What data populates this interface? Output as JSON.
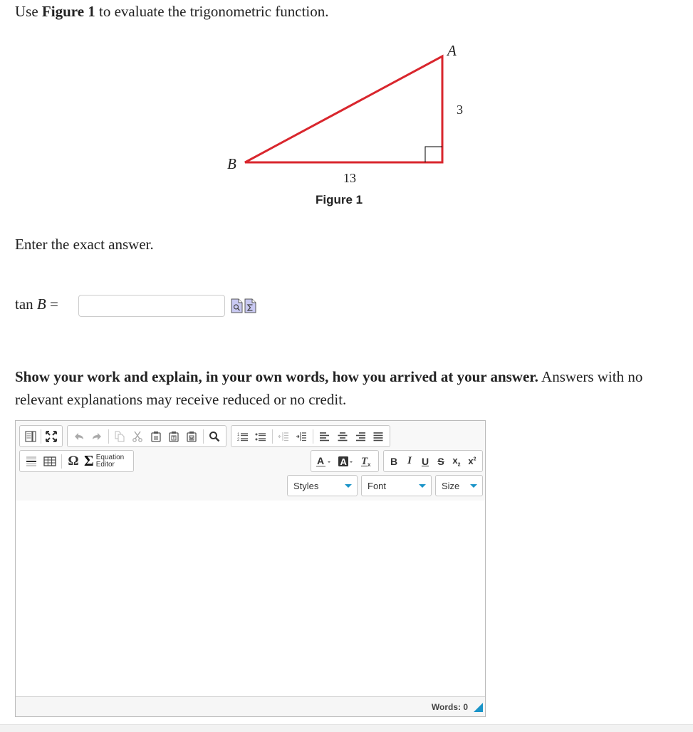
{
  "question": {
    "intro_prefix": "Use ",
    "intro_bold": "Figure 1",
    "intro_suffix": " to evaluate the trigonometric function.",
    "enter_exact": "Enter the exact answer.",
    "answer_label_fn": "tan",
    "answer_label_var": "B",
    "answer_label_eq": "=",
    "answer_value": "",
    "answer_placeholder": ""
  },
  "figure": {
    "caption": "Figure 1",
    "vertex_a": "A",
    "vertex_b": "B",
    "side_vertical": "3",
    "side_horizontal": "13",
    "line_color": "#d9262d",
    "right_angle_marker": true
  },
  "tool_icons": {
    "preview": "preview-icon",
    "equation": "equation-icon"
  },
  "show_work": {
    "bold": "Show your work and explain, in your own words, how you arrived at your answer.",
    "normal": " Answers with no relevant explanations may receive reduced or no credit."
  },
  "editor": {
    "toolbar_row1": [
      "show-blocks",
      "maximize",
      "undo",
      "redo",
      "copy",
      "cut",
      "paste",
      "paste-as-text",
      "paste-from-word",
      "find",
      "numbered-list",
      "bulleted-list",
      "decrease-indent",
      "increase-indent",
      "align-left",
      "align-center",
      "align-right",
      "justify"
    ],
    "toolbar_row2": [
      "horizontal-line",
      "table",
      "special-character",
      "equation-editor",
      "text-color",
      "background-color",
      "remove-format",
      "bold",
      "italic",
      "underline",
      "strikethrough",
      "subscript",
      "superscript"
    ],
    "equation_editor_label_1": "Equation",
    "equation_editor_label_2": "Editor",
    "styles_label": "Styles",
    "font_label": "Font",
    "size_label": "Size",
    "body_text": "",
    "words_label": "Words: 0",
    "accent_color": "#1a94c8"
  }
}
